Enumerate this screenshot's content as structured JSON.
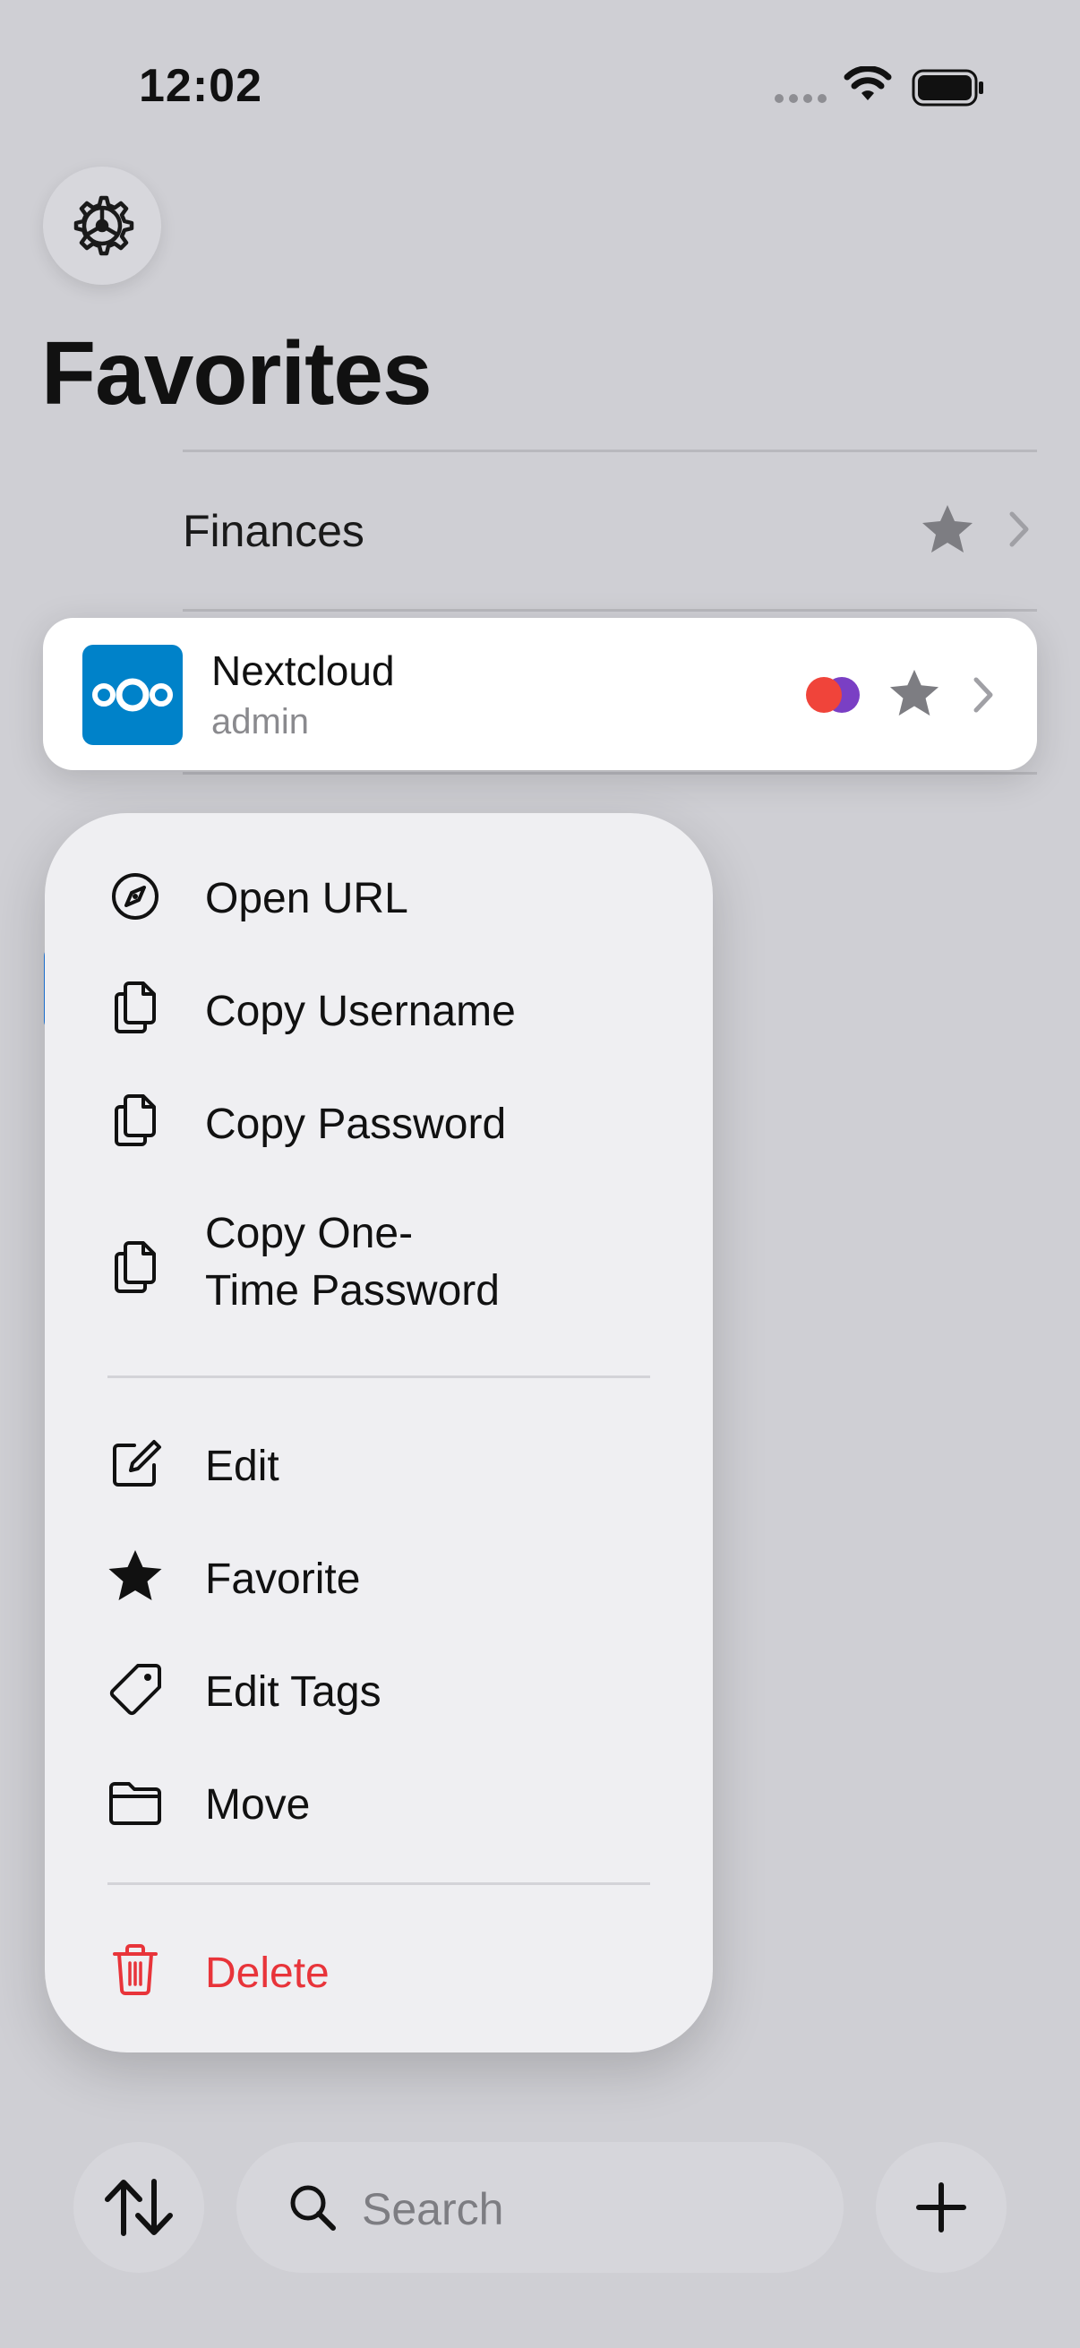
{
  "status_bar": {
    "time": "12:02"
  },
  "header": {
    "title": "Favorites",
    "settings_icon": "gear-icon"
  },
  "rows": [
    {
      "label": "Finances",
      "icon": "folder-icon",
      "favorite": true
    }
  ],
  "selected_entry": {
    "title": "Nextcloud",
    "subtitle": "admin",
    "icon": "nextcloud-logo",
    "tag_colors": [
      "#f0443a",
      "#7a3fc4"
    ],
    "favorite": true
  },
  "context_menu": {
    "items": [
      {
        "label": "Open URL",
        "icon": "compass-icon"
      },
      {
        "label": "Copy Username",
        "icon": "copy-icon"
      },
      {
        "label": "Copy Password",
        "icon": "copy-icon"
      },
      {
        "label_line1": "Copy One-",
        "label_line2": "Time Password",
        "icon": "copy-icon"
      },
      {
        "label": "Edit",
        "icon": "edit-icon"
      },
      {
        "label": "Favorite",
        "icon": "star-icon"
      },
      {
        "label": "Edit Tags",
        "icon": "tag-icon"
      },
      {
        "label": "Move",
        "icon": "folder-icon"
      },
      {
        "label": "Delete",
        "icon": "trash-icon",
        "color": "#e8343a"
      }
    ]
  },
  "bottom_bar": {
    "sort_icon": "sort-arrows-icon",
    "search_placeholder": "Search",
    "add_icon": "plus-icon"
  }
}
